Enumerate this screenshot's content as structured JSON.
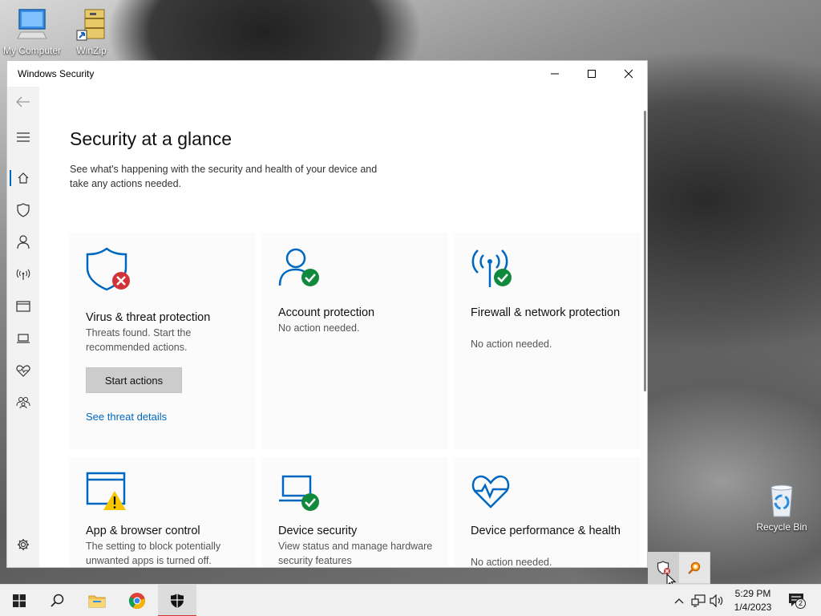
{
  "desktop": {
    "icons": [
      {
        "label": "My Computer"
      },
      {
        "label": "WinZip"
      },
      {
        "label": "Recycle Bin"
      }
    ]
  },
  "window": {
    "title": "Windows Security",
    "controls": {
      "minimize": "—",
      "maximize": "☐",
      "close": "✕"
    }
  },
  "page": {
    "title": "Security at a glance",
    "subtitle": "See what's happening with the security and health of your device and take any actions needed."
  },
  "tiles": [
    {
      "title": "Virus & threat protection",
      "desc": "Threats found. Start the recommended actions.",
      "button": "Start actions",
      "link": "See threat details"
    },
    {
      "title": "Account protection",
      "desc": "No action needed."
    },
    {
      "title": "Firewall & network protection",
      "desc": "No action needed."
    },
    {
      "title": "App & browser control",
      "desc": "The setting to block potentially unwanted apps is turned off."
    },
    {
      "title": "Device security",
      "desc": "View status and manage hardware security features"
    },
    {
      "title": "Device performance & health",
      "desc": "No action needed."
    }
  ],
  "taskbar": {
    "clock_time": "5:29 PM",
    "clock_date": "1/4/2023",
    "notification_count": "2"
  },
  "colors": {
    "accent": "#0067c0",
    "ok_green": "#0f8a3c",
    "error_red": "#d13438",
    "warning_yellow": "#f7c600"
  }
}
